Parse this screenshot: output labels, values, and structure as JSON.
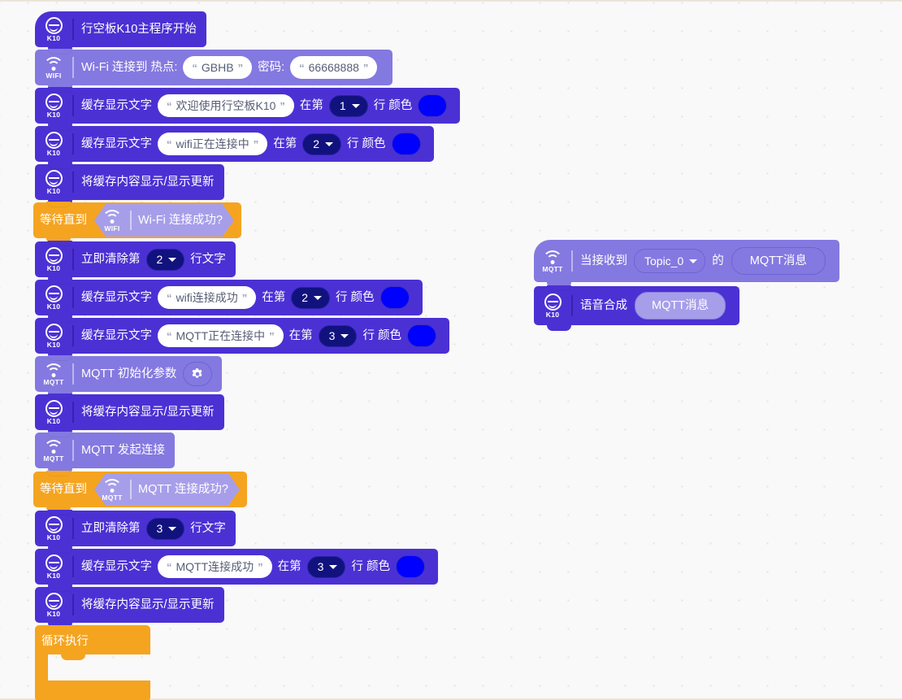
{
  "app": {
    "canvas_name": "blockly-workspace",
    "background": "#f9f9f9",
    "grid_dot_color": "#e6e3e0"
  },
  "palette": {
    "device_purple": "#4b31d4",
    "network_indigo": "#8479e0",
    "control_orange": "#f5a420",
    "dropdown_navy": "#12127e",
    "text_field_white": "#ffffff",
    "color_swatch": "#0000ff"
  },
  "icons": {
    "k10": "K10",
    "wifi": "WIFI",
    "mqtt": "MQTT"
  },
  "main_script": {
    "blocks": [
      {
        "id": "hat-start",
        "icon": "K10",
        "label": "行空板K10主程序开始"
      },
      {
        "id": "wifi-connect",
        "icon": "WIFI",
        "label_a": "Wi-Fi 连接到 热点:",
        "ssid": "GBHB",
        "label_b": "密码:",
        "password": "66668888"
      },
      {
        "id": "buffer-text-1",
        "icon": "K10",
        "label_a": "缓存显示文字",
        "text": "欢迎使用行空板K10",
        "label_b": "在第",
        "line": "1",
        "label_c": "行 颜色",
        "color": "#0000ff"
      },
      {
        "id": "buffer-text-2",
        "icon": "K10",
        "label_a": "缓存显示文字",
        "text": "wifi正在连接中",
        "label_b": "在第",
        "line": "2",
        "label_c": "行 颜色",
        "color": "#0000ff"
      },
      {
        "id": "refresh-1",
        "icon": "K10",
        "label": "将缓存内容显示/显示更新"
      },
      {
        "id": "wait-wifi",
        "label": "等待直到",
        "condition_icon": "WIFI",
        "condition": "Wi-Fi 连接成功?"
      },
      {
        "id": "clear-line-2",
        "icon": "K10",
        "label_a": "立即清除第",
        "line": "2",
        "label_b": "行文字"
      },
      {
        "id": "buffer-text-3",
        "icon": "K10",
        "label_a": "缓存显示文字",
        "text": "wifi连接成功",
        "label_b": "在第",
        "line": "2",
        "label_c": "行 颜色",
        "color": "#0000ff"
      },
      {
        "id": "buffer-text-4",
        "icon": "K10",
        "label_a": "缓存显示文字",
        "text": "MQTT正在连接中",
        "label_b": "在第",
        "line": "3",
        "label_c": "行 颜色",
        "color": "#0000ff"
      },
      {
        "id": "mqtt-init",
        "icon": "MQTT",
        "label": "MQTT 初始化参数",
        "settings_icon": "gear-icon"
      },
      {
        "id": "refresh-2",
        "icon": "K10",
        "label": "将缓存内容显示/显示更新"
      },
      {
        "id": "mqtt-connect",
        "icon": "MQTT",
        "label": "MQTT 发起连接"
      },
      {
        "id": "wait-mqtt",
        "label": "等待直到",
        "condition_icon": "MQTT",
        "condition": "MQTT 连接成功?"
      },
      {
        "id": "clear-line-3",
        "icon": "K10",
        "label_a": "立即清除第",
        "line": "3",
        "label_b": "行文字"
      },
      {
        "id": "buffer-text-5",
        "icon": "K10",
        "label_a": "缓存显示文字",
        "text": "MQTT连接成功",
        "label_b": "在第",
        "line": "3",
        "label_c": "行 颜色",
        "color": "#0000ff"
      },
      {
        "id": "refresh-3",
        "icon": "K10",
        "label": "将缓存内容显示/显示更新"
      },
      {
        "id": "forever-loop",
        "label": "循环执行"
      }
    ]
  },
  "event_script": {
    "blocks": [
      {
        "id": "on-mqtt-message",
        "icon": "MQTT",
        "label_a": "当接收到",
        "topic": "Topic_0",
        "label_b": "的",
        "payload": "MQTT消息"
      },
      {
        "id": "tts-speak",
        "icon": "K10",
        "label": "语音合成",
        "argument": "MQTT消息"
      }
    ]
  }
}
